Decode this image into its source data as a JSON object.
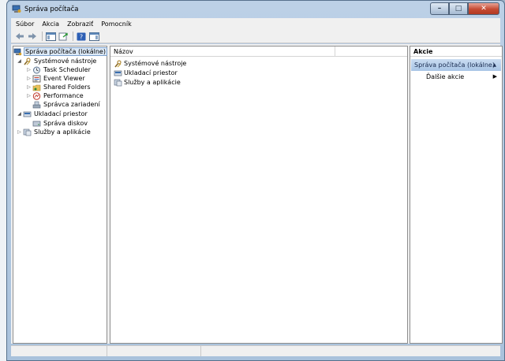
{
  "window": {
    "title": "Správa počítača"
  },
  "menu": [
    "Súbor",
    "Akcia",
    "Zobraziť",
    "Pomocník"
  ],
  "tree": {
    "items": [
      {
        "label": "Správa počítača (lokálne)",
        "icon": "computer-management-icon",
        "level": 0,
        "selected": true
      },
      {
        "label": "Systémové nástroje",
        "icon": "tools-icon",
        "level": 1,
        "expanded": true
      },
      {
        "label": "Task Scheduler",
        "icon": "clock-icon",
        "level": 2
      },
      {
        "label": "Event Viewer",
        "icon": "event-viewer-icon",
        "level": 2
      },
      {
        "label": "Shared Folders",
        "icon": "shared-folder-icon",
        "level": 2
      },
      {
        "label": "Performance",
        "icon": "performance-icon",
        "level": 2
      },
      {
        "label": "Správca zariadení",
        "icon": "device-manager-icon",
        "level": 2
      },
      {
        "label": "Ukladací priestor",
        "icon": "storage-icon",
        "level": 1,
        "expanded": true
      },
      {
        "label": "Správa diskov",
        "icon": "disk-icon",
        "level": 2
      },
      {
        "label": "Služby a aplikácie",
        "icon": "services-icon",
        "level": 1
      }
    ]
  },
  "list": {
    "column": "Názov",
    "rows": [
      "Systémové nástroje",
      "Ukladací priestor",
      "Služby a aplikácie"
    ]
  },
  "actions": {
    "header": "Akcie",
    "section": "Správa počítača (lokálne)",
    "item": "Ďalšie akcie"
  },
  "colors": {
    "selection": "#dce9f7",
    "actions_section": "#b9d1ec",
    "title_bar": "#b6cbe2"
  }
}
